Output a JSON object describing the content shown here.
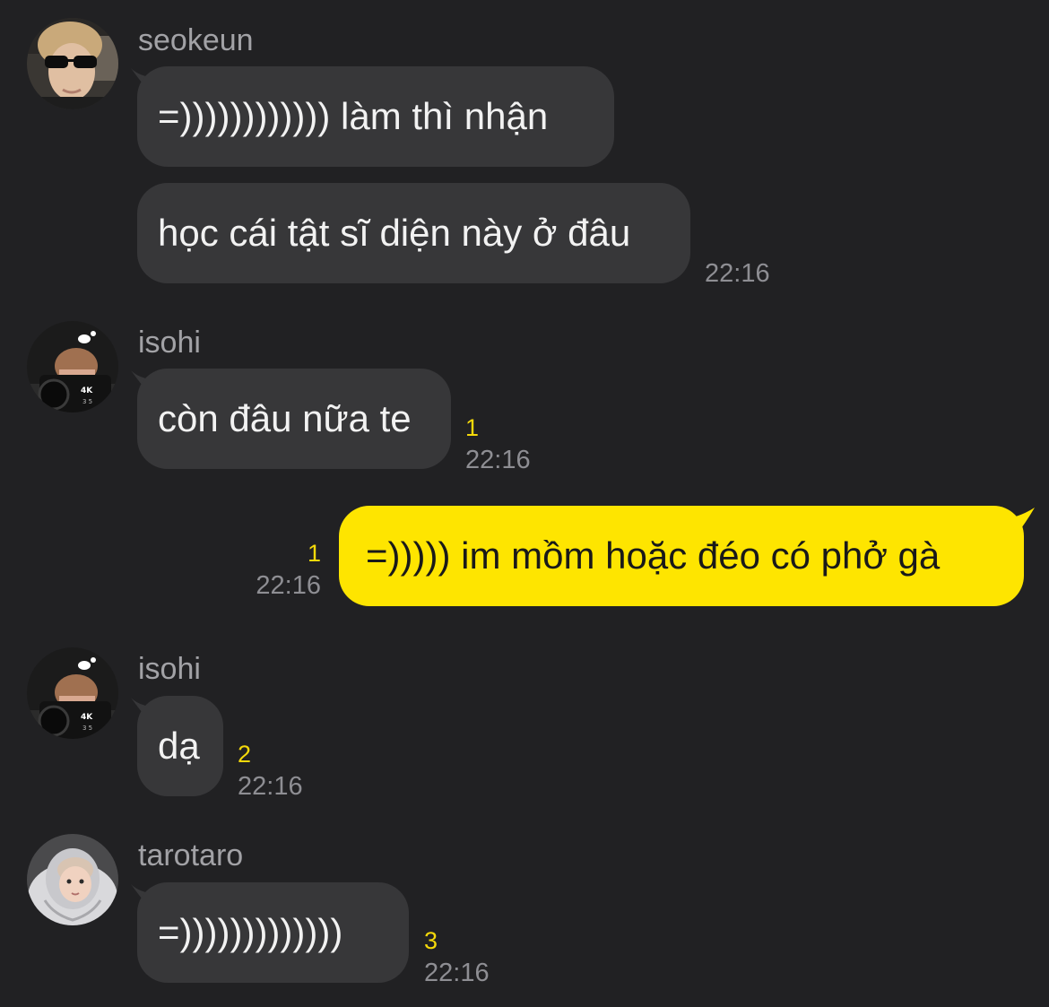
{
  "colors": {
    "background": "#212123",
    "incoming_bubble": "#373739",
    "outgoing_bubble": "#fee500",
    "unread_count": "#f5d90a",
    "timestamp": "#8e8e93",
    "sender_name": "#a2a2a6"
  },
  "groups": [
    {
      "sender": "seokeun",
      "avatar": "avatar-seokeun-sunglasses",
      "messages": [
        "=)))))))))))) làm thì nhận",
        "học cái tật sĩ diện này ở đâu"
      ],
      "unread": "",
      "time": "22:16"
    },
    {
      "sender": "isohi",
      "avatar": "avatar-isohi-camera",
      "messages": [
        "còn đâu nữa te"
      ],
      "unread": "1",
      "time": "22:16"
    },
    {
      "sender": "me",
      "messages": [
        "=))))) im mồm hoặc đéo có phở gà"
      ],
      "unread": "1",
      "time": "22:16"
    },
    {
      "sender": "isohi",
      "avatar": "avatar-isohi-camera",
      "messages": [
        "dạ"
      ],
      "unread": "2",
      "time": "22:16"
    },
    {
      "sender": "tarotaro",
      "avatar": "avatar-tarotaro-hood",
      "messages": [
        "=)))))))))))))"
      ],
      "unread": "3",
      "time": "22:16"
    }
  ]
}
